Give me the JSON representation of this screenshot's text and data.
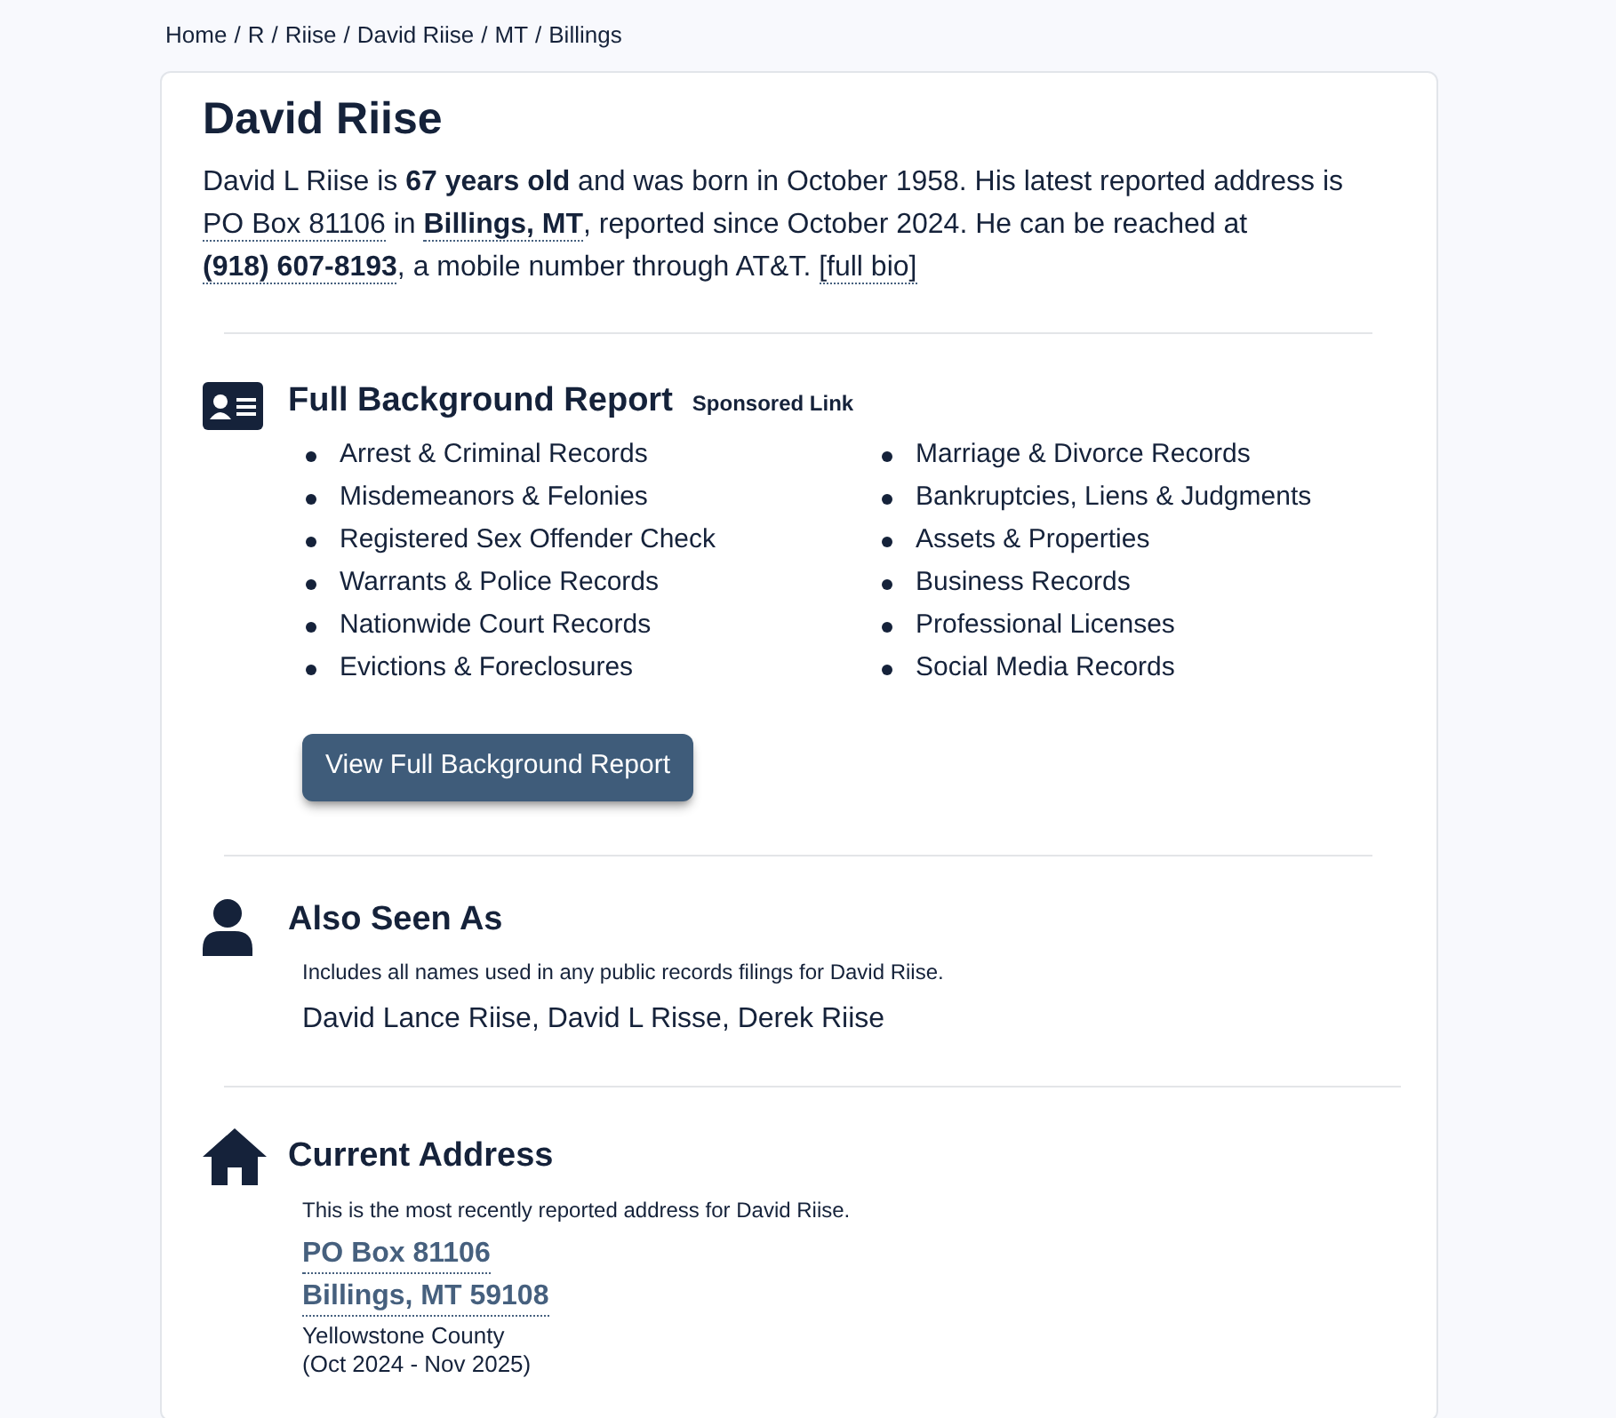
{
  "breadcrumb": {
    "separator": "/",
    "items": [
      "Home",
      "R",
      "Riise",
      "David Riise",
      "MT",
      "Billings"
    ]
  },
  "person": {
    "name": "David Riise",
    "bio": [
      {
        "kind": "text",
        "text": "David L Riise is "
      },
      {
        "kind": "bold",
        "text": "67 years old"
      },
      {
        "kind": "text",
        "text": " and was born in October 1958. His latest reported address is "
      },
      {
        "kind": "link",
        "text": "PO Box 81106"
      },
      {
        "kind": "text",
        "text": " in "
      },
      {
        "kind": "bold_link",
        "text": "Billings, MT"
      },
      {
        "kind": "text",
        "text": ", reported since October 2024. He can be reached at "
      },
      {
        "kind": "bold_link",
        "text": "(918) 607-8193"
      },
      {
        "kind": "text",
        "text": ", a mobile number through AT&T. "
      },
      {
        "kind": "link",
        "text": "[full bio]"
      }
    ]
  },
  "background_report": {
    "title": "Full Background Report",
    "badge": "Sponsored Link",
    "columns": [
      [
        "Arrest & Criminal Records",
        "Misdemeanors & Felonies",
        "Registered Sex Offender Check",
        "Warrants & Police Records",
        "Nationwide Court Records",
        "Evictions & Foreclosures"
      ],
      [
        "Marriage & Divorce Records",
        "Bankruptcies, Liens & Judgments",
        "Assets & Properties",
        "Business Records",
        "Professional Licenses",
        "Social Media Records"
      ]
    ],
    "button": "View Full Background Report"
  },
  "also_seen_as": {
    "title": "Also Seen As",
    "description": "Includes all names used in any public records filings for David Riise.",
    "names": "David Lance Riise, David L Risse, Derek Riise"
  },
  "current_address": {
    "title": "Current Address",
    "description": "This is the most recently reported address for David Riise.",
    "street": "PO Box 81106",
    "city": "Billings, MT 59108",
    "county": "Yellowstone County",
    "dates": "(Oct 2024 - Nov 2025)"
  }
}
